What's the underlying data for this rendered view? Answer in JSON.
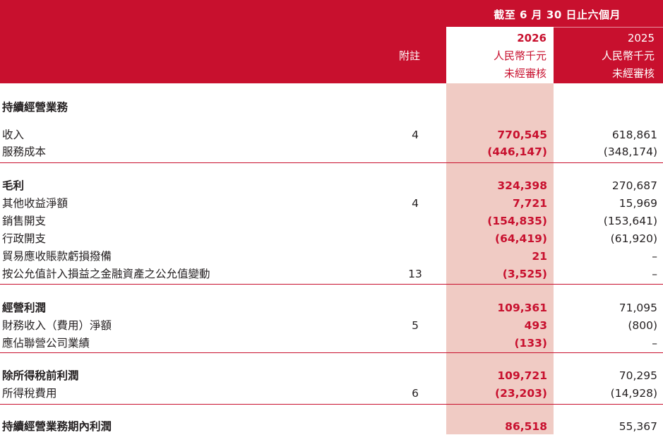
{
  "header": {
    "period_label": "截至 6 月 30 日止六個月",
    "note_label": "附註",
    "current": {
      "year": "2026",
      "currency": "人民幣千元",
      "status": "未經審核"
    },
    "prior": {
      "year": "2025",
      "currency": "人民幣千元",
      "status": "未經審核"
    }
  },
  "rows": [
    {
      "label": "持續經營業務",
      "note": "",
      "current": "",
      "prior": "",
      "bold": true
    },
    {
      "label": "收入",
      "note": "4",
      "current": "770,545",
      "prior": "618,861",
      "bold": false
    },
    {
      "label": "服務成本",
      "note": "",
      "current": "(446,147)",
      "prior": "(348,174)",
      "bold": false
    },
    {
      "label": "毛利",
      "note": "",
      "current": "324,398",
      "prior": "270,687",
      "bold": true
    },
    {
      "label": "其他收益淨額",
      "note": "4",
      "current": "7,721",
      "prior": "15,969",
      "bold": false
    },
    {
      "label": "銷售開支",
      "note": "",
      "current": "(154,835)",
      "prior": "(153,641)",
      "bold": false
    },
    {
      "label": "行政開支",
      "note": "",
      "current": "(64,419)",
      "prior": "(61,920)",
      "bold": false
    },
    {
      "label": "貿易應收賬款虧損撥備",
      "note": "",
      "current": "21",
      "prior": "–",
      "bold": false
    },
    {
      "label": "按公允值計入損益之金融資產之公允值變動",
      "note": "13",
      "current": "(3,525)",
      "prior": "–",
      "bold": false
    },
    {
      "label": "經營利潤",
      "note": "",
      "current": "109,361",
      "prior": "71,095",
      "bold": true
    },
    {
      "label": "財務收入（費用）淨額",
      "note": "5",
      "current": "493",
      "prior": "(800)",
      "bold": false
    },
    {
      "label": "應佔聯營公司業績",
      "note": "",
      "current": "(133)",
      "prior": "–",
      "bold": false
    },
    {
      "label": "除所得稅前利潤",
      "note": "",
      "current": "109,721",
      "prior": "70,295",
      "bold": true
    },
    {
      "label": "所得稅費用",
      "note": "6",
      "current": "(23,203)",
      "prior": "(14,928)",
      "bold": false
    },
    {
      "label": "持續經營業務期內利潤",
      "note": "",
      "current": "86,518",
      "prior": "55,367",
      "bold": true
    }
  ],
  "colors": {
    "brand_red": "#c8102e",
    "highlight": "#f0cbc4",
    "text": "#231f20"
  }
}
